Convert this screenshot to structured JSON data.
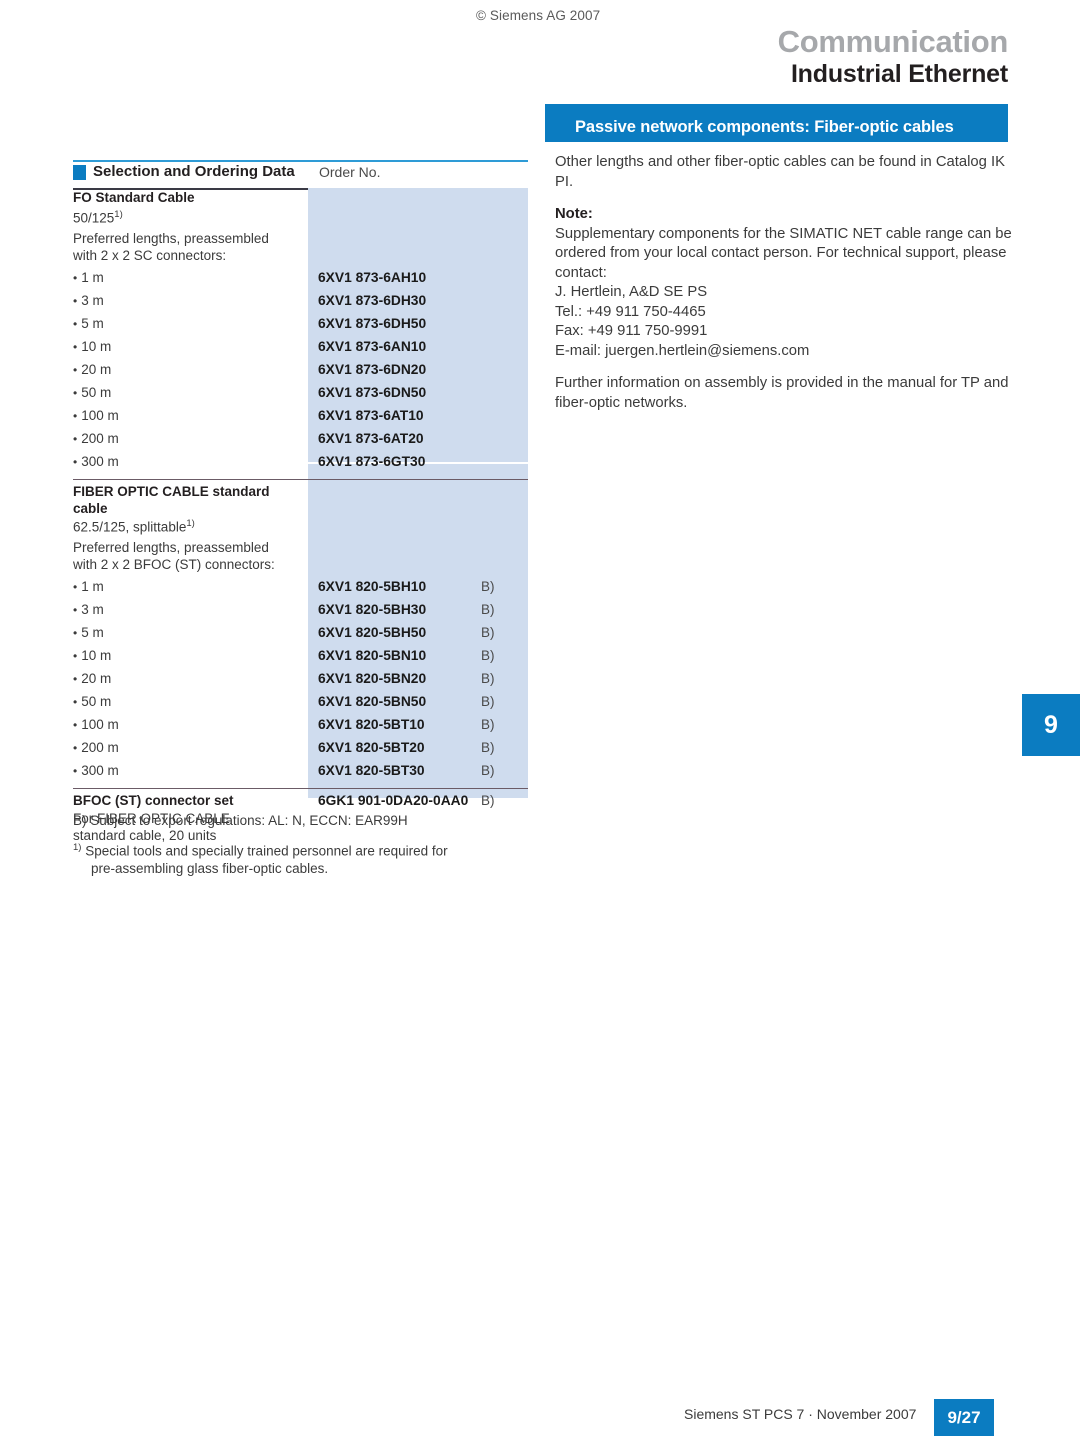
{
  "header": {
    "copyright": "© Siemens AG 2007",
    "brand_main": "Communication",
    "brand_sub": "Industrial Ethernet",
    "title_bar": "Passive network components: Fiber-optic cables"
  },
  "table": {
    "header_title": "Selection and Ordering Data",
    "header_order": "Order No.",
    "sections": [
      {
        "title": "FO Standard Cable",
        "subtitle": "50/125",
        "subtitle_sup": "1)",
        "intro_lines": [
          "Preferred lengths, preassembled",
          "with 2 x 2 SC connectors:"
        ],
        "rows": [
          {
            "length": "1 m",
            "order_no": "6XV1 873-6AH10",
            "flag": ""
          },
          {
            "length": "3 m",
            "order_no": "6XV1 873-6DH30",
            "flag": ""
          },
          {
            "length": "5 m",
            "order_no": "6XV1 873-6DH50",
            "flag": ""
          },
          {
            "length": "10 m",
            "order_no": "6XV1 873-6AN10",
            "flag": ""
          },
          {
            "length": "20 m",
            "order_no": "6XV1 873-6DN20",
            "flag": ""
          },
          {
            "length": "50 m",
            "order_no": "6XV1 873-6DN50",
            "flag": ""
          },
          {
            "length": "100 m",
            "order_no": "6XV1 873-6AT10",
            "flag": ""
          },
          {
            "length": "200 m",
            "order_no": "6XV1 873-6AT20",
            "flag": ""
          },
          {
            "length": "300 m",
            "order_no": "6XV1 873-6GT30",
            "flag": ""
          }
        ]
      },
      {
        "title_line1": "FIBER OPTIC CABLE standard",
        "title_line2": "cable",
        "subtitle": "62.5/125, splittable",
        "subtitle_sup": "1)",
        "intro_lines": [
          "Preferred lengths, preassembled",
          "with 2 x 2 BFOC (ST) connectors:"
        ],
        "rows": [
          {
            "length": "1 m",
            "order_no": "6XV1 820-5BH10",
            "flag": "B)"
          },
          {
            "length": "3 m",
            "order_no": "6XV1 820-5BH30",
            "flag": "B)"
          },
          {
            "length": "5 m",
            "order_no": "6XV1 820-5BH50",
            "flag": "B)"
          },
          {
            "length": "10 m",
            "order_no": "6XV1 820-5BN10",
            "flag": "B)"
          },
          {
            "length": "20 m",
            "order_no": "6XV1 820-5BN20",
            "flag": "B)"
          },
          {
            "length": "50 m",
            "order_no": "6XV1 820-5BN50",
            "flag": "B)"
          },
          {
            "length": "100 m",
            "order_no": "6XV1 820-5BT10",
            "flag": "B)"
          },
          {
            "length": "200 m",
            "order_no": "6XV1 820-5BT20",
            "flag": "B)"
          },
          {
            "length": "300 m",
            "order_no": "6XV1 820-5BT30",
            "flag": "B)"
          }
        ]
      },
      {
        "title": "BFOC (ST) connector set",
        "order_no": "6GK1 901-0DA20-0AA0",
        "flag": "B)",
        "desc_lines": [
          "For FIBER OPTIC CABLE",
          "standard cable, 20 units"
        ]
      }
    ]
  },
  "footnotes": {
    "b": "B) Subject to export regulations: AL: N, ECCN: EAR99H",
    "one_sup": "1)",
    "one_line1": "Special tools and specially trained personnel are required for",
    "one_line2": "pre-assembling glass fiber-optic cables."
  },
  "right_column": {
    "intro": "Other lengths and other fiber-optic cables can be found in Catalog IK PI.",
    "note_label": "Note:",
    "note_body": "Supplementary components for the SIMATIC NET cable range can be ordered from your local contact person. For technical support, please contact:",
    "contact_name": "J. Hertlein, A&D SE PS",
    "contact_tel": "Tel.: +49 911 750-4465",
    "contact_fax": "Fax: +49 911 750-9991",
    "contact_email": "E-mail: juergen.hertlein@siemens.com",
    "closing": "Further information on assembly is provided in the manual for TP and fiber-optic networks."
  },
  "side_tab": {
    "number": "9"
  },
  "footer": {
    "text": "Siemens ST PCS 7 · November 2007",
    "page": "9/27"
  },
  "colors": {
    "accent_blue": "#0b7cc1",
    "rule_blue": "#2e9bd6",
    "shade": "#cfdcee",
    "brand_gray": "#a6a8ab"
  }
}
